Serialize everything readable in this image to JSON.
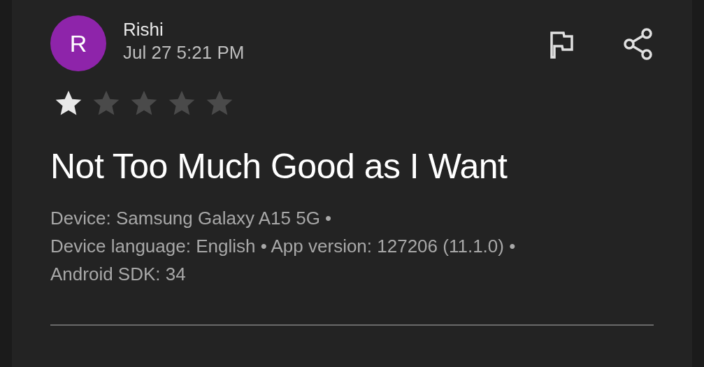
{
  "review": {
    "avatar_letter": "R",
    "color": "#8e24aa",
    "author": "Rishi",
    "date": "Jul 27 5:21 PM",
    "stars": 1,
    "title": "Not Too Much Good as I Want",
    "details": [
      "Device: Samsung Galaxy A15 5G •",
      "Device language: English • App version: 127206 (11.1.0) •",
      "Android SDK: 34"
    ]
  }
}
